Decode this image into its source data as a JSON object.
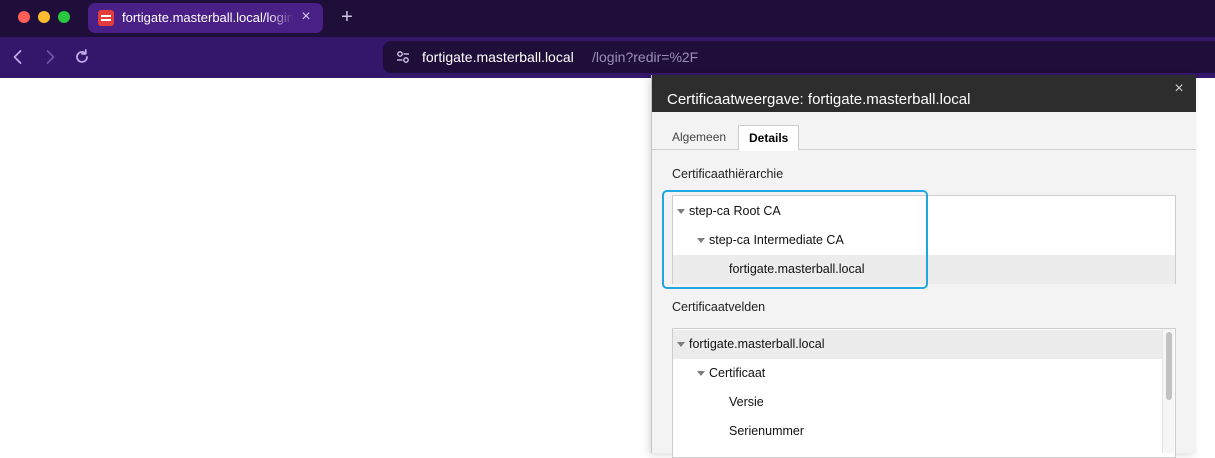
{
  "browser": {
    "tab_title": "fortigate.masterball.local/login?redir=%2F",
    "tab_close": "×",
    "new_tab": "+",
    "url_host": "fortigate.masterball.local",
    "url_path": "/login?redir=%2F",
    "icons": {
      "back": "chevron-left-icon",
      "forward": "chevron-right-icon",
      "reload": "reload-icon",
      "site_settings": "tune-icon",
      "favicon": "fortigate-favicon"
    },
    "colors": {
      "titlebar": "#1f0e3a",
      "toolbar": "#34176a",
      "active_tab": "#4a1f86"
    }
  },
  "dialog": {
    "title": "Certificaatweergave: fortigate.masterball.local",
    "close_glyph": "×",
    "tabs": [
      {
        "label": "Algemeen",
        "active": false
      },
      {
        "label": "Details",
        "active": true
      }
    ],
    "hierarchy_label": "Certificaathiërarchie",
    "hierarchy": [
      {
        "label": "step-ca Root CA",
        "expanded": true,
        "selected": false
      },
      {
        "label": "step-ca Intermediate CA",
        "expanded": true,
        "selected": false
      },
      {
        "label": "fortigate.masterball.local",
        "expanded": false,
        "selected": true
      }
    ],
    "fields_label": "Certificaatvelden",
    "fields": [
      {
        "label": "fortigate.masterball.local",
        "expanded": true,
        "selected": true
      },
      {
        "label": "Certificaat",
        "expanded": true,
        "selected": false
      },
      {
        "label": "Versie",
        "expanded": false,
        "selected": false
      },
      {
        "label": "Serienummer",
        "expanded": false,
        "selected": false
      }
    ],
    "highlight_color": "#1ea7e0"
  }
}
